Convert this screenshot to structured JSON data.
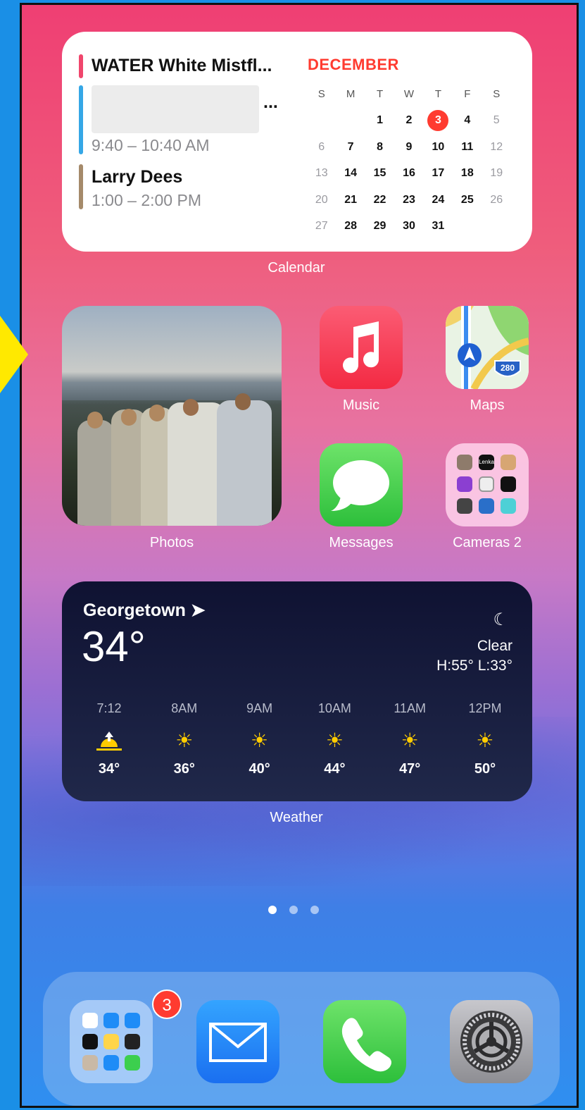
{
  "calendar": {
    "widget_label": "Calendar",
    "month": "DECEMBER",
    "events": [
      {
        "title": "WATER White Mistfl...",
        "time": "",
        "color": "#f0466c"
      },
      {
        "title": "...",
        "time": "9:40 – 10:40 AM",
        "color": "#35a7e6"
      },
      {
        "title": "Larry Dees",
        "time": "1:00 – 2:00 PM",
        "color": "#a58a6a"
      }
    ],
    "weekdays": [
      "S",
      "M",
      "T",
      "W",
      "T",
      "F",
      "S"
    ],
    "weeks": [
      [
        "",
        "",
        "1",
        "2",
        "3",
        "4",
        "5"
      ],
      [
        "6",
        "7",
        "8",
        "9",
        "10",
        "11",
        "12"
      ],
      [
        "13",
        "14",
        "15",
        "16",
        "17",
        "18",
        "19"
      ],
      [
        "20",
        "21",
        "22",
        "23",
        "24",
        "25",
        "26"
      ],
      [
        "27",
        "28",
        "29",
        "30",
        "31",
        "",
        ""
      ]
    ],
    "today": "3"
  },
  "photos": {
    "label": "Photos"
  },
  "apps": {
    "music": {
      "label": "Music",
      "icon": "music-note-icon"
    },
    "maps": {
      "label": "Maps",
      "icon": "maps-icon",
      "shield": "280"
    },
    "messages": {
      "label": "Messages",
      "icon": "speech-bubble-icon"
    },
    "folder": {
      "label": "Cameras 2",
      "icon": "folder-icon",
      "mini_label": "Lenka"
    }
  },
  "weather": {
    "widget_label": "Weather",
    "city": "Georgetown",
    "location_icon": "location-arrow-icon",
    "temp": "34°",
    "condition": "Clear",
    "hi_lo": "H:55° L:33°",
    "condition_icon": "moon-stars-icon",
    "hours": [
      {
        "time": "7:12",
        "icon": "sunrise-icon",
        "temp": "34°"
      },
      {
        "time": "8AM",
        "icon": "sun-icon",
        "temp": "36°"
      },
      {
        "time": "9AM",
        "icon": "sun-icon",
        "temp": "40°"
      },
      {
        "time": "10AM",
        "icon": "sun-icon",
        "temp": "44°"
      },
      {
        "time": "11AM",
        "icon": "sun-icon",
        "temp": "47°"
      },
      {
        "time": "12PM",
        "icon": "sun-icon",
        "temp": "50°"
      }
    ]
  },
  "page_dots": {
    "count": 3,
    "active": 1
  },
  "dock": {
    "folder_badge": "3",
    "items": [
      "apps-folder",
      "mail",
      "phone",
      "settings"
    ]
  }
}
